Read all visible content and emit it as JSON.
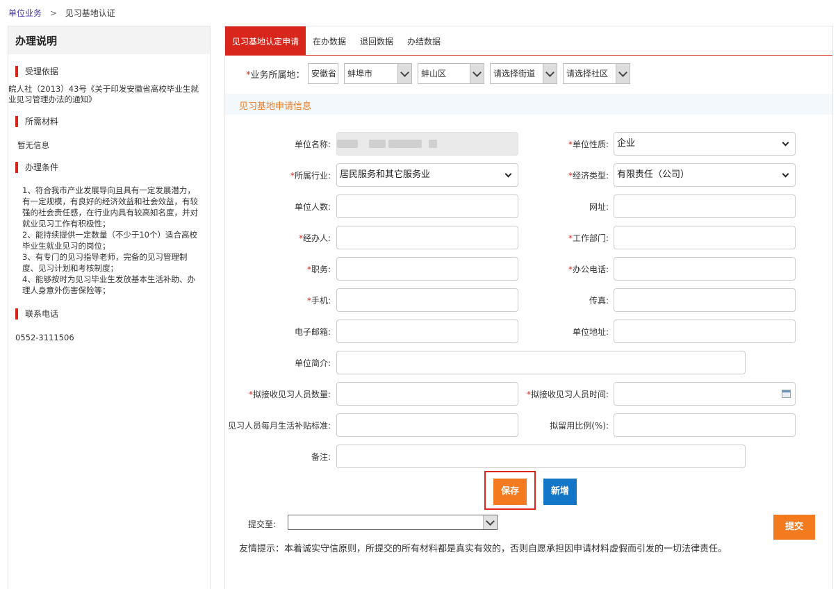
{
  "breadcrumb": {
    "link": "单位业务",
    "sep": ">",
    "current": "见习基地认证"
  },
  "left": {
    "title": "办理说明",
    "basis_head": "受理依据",
    "basis_text_1": "皖人社（2013）43号《关于印发安徽省高校毕业生就",
    "basis_text_2": "业见习管理办法的通知》",
    "materials_head": "所需材料",
    "materials_text": "暂无信息",
    "conditions_head": "办理条件",
    "conditions": [
      "1、符合我市产业发展导向且具有一定发展潜力，",
      "有一定规模，有良好的经济效益和社会效益，有较",
      "强的社会责任感，在行业内具有较高知名度，并对",
      "就业见习工作有积极性；",
      "2、能持续提供一定数量（不少于10个）适合高校",
      "毕业生就业见习的岗位；",
      "3、有专门的见习指导老师，完备的见习管理制",
      "度、见习计划和考核制度；",
      "4、能够按时为见习毕业生发放基本生活补助、办",
      "理人身意外伤害保险等；"
    ],
    "phone_head": "联系电话",
    "phone": "0552-3111506"
  },
  "tabs": [
    "见习基地认定申请",
    "在办数据",
    "退回数据",
    "办结数据"
  ],
  "region": {
    "label": "业务所属地：",
    "province": "安徽省",
    "city": "蚌埠市",
    "district": "蚌山区",
    "street": "请选择街道",
    "community": "请选择社区"
  },
  "section_title": "见习基地申请信息",
  "form": {
    "unit_name_label": "单位名称:",
    "unit_nature_label": "单位性质:",
    "unit_nature_value": "企业",
    "industry_label": "所属行业:",
    "industry_value": "居民服务和其它服务业",
    "econ_type_label": "经济类型:",
    "econ_type_value": "有限责任（公司）",
    "staff_count_label": "单位人数:",
    "website_label": "网址:",
    "handler_label": "经办人:",
    "department_label": "工作部门:",
    "position_label": "职务:",
    "office_phone_label": "办公电话:",
    "mobile_label": "手机:",
    "fax_label": "传真:",
    "email_label": "电子邮箱:",
    "address_label": "单位地址:",
    "intro_label": "单位简介:",
    "intern_count_label": "拟接收见习人员数量:",
    "intern_time_label": "拟接收见习人员时间:",
    "subsidy_label": "见习人员每月生活补贴标准:",
    "retention_label": "拟留用比例(%):",
    "remark_label": "备注:"
  },
  "buttons": {
    "save": "保存",
    "add": "新增",
    "submit": "提交"
  },
  "submit_to_label": "提交至:",
  "tip": "友情提示：本着诚实守信原则，所提交的所有材料都是真实有效的，否则自愿承担因申请材料虚假而引发的一切法律责任。",
  "colors": {
    "accent": "#d9261c",
    "orange": "#f47a20",
    "blue": "#1376c6"
  }
}
